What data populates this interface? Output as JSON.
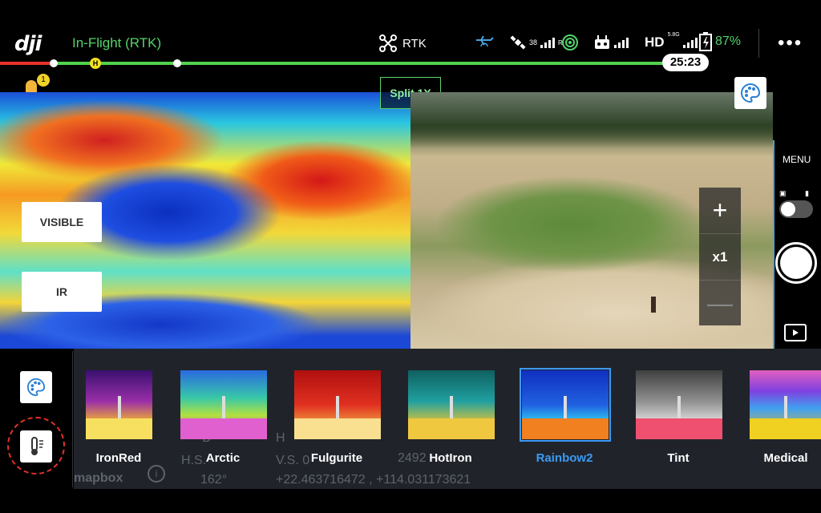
{
  "header": {
    "logo": "dji",
    "flight_status": "In-Flight (RTK)",
    "rtk_label": "RTK",
    "satellite_count": "38",
    "gps_mode": "R",
    "hd_label": "HD",
    "hd_band": "5.8G",
    "battery_percent": "87%",
    "more_label": "•••"
  },
  "timeline": {
    "home_marker": "H",
    "elapsed_time": "25:23",
    "pin_badge": "1"
  },
  "split_view": {
    "tag": "Split 1X",
    "visible_button": "VISIBLE",
    "ir_button": "IR"
  },
  "zoom": {
    "plus": "+",
    "level": "x1",
    "minus": "—"
  },
  "camera_panel": {
    "menu_label": "MENU"
  },
  "map_overlay": {
    "dist_label": "D",
    "hs_label": "H.S.",
    "heading": "162°",
    "height_prefix": "H",
    "vs_prefix": "V.S. 0",
    "distance_code": "2492",
    "coordinates": "+22.463716472 , +114.031173621",
    "map_brand": "mapbox"
  },
  "palettes": [
    {
      "label": "IronRed"
    },
    {
      "label": "Arctic"
    },
    {
      "label": "Fulgurite"
    },
    {
      "label": "HotIron"
    },
    {
      "label": "Rainbow2"
    },
    {
      "label": "Tint"
    },
    {
      "label": "Medical"
    }
  ],
  "colors": {
    "accent_green": "#53d36b",
    "selected_blue": "#3b9af5",
    "warning_red": "#e0312b"
  }
}
